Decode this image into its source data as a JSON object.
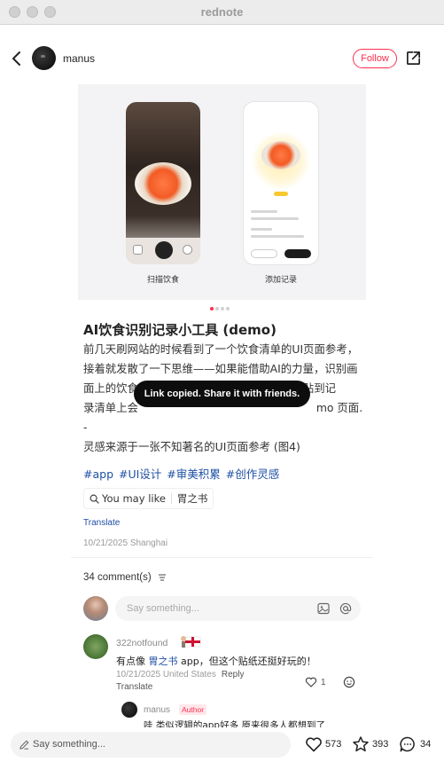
{
  "window": {
    "title": "rednote"
  },
  "header": {
    "author": "manus",
    "follow_label": "Follow"
  },
  "media": {
    "captions": [
      "扫描饮食",
      "添加记录"
    ],
    "page_count": 4,
    "active_page": 1
  },
  "post": {
    "title": "AI饮食识别记录小工具 (demo)",
    "body_lines": [
      "前几天刷网站的时候看到了一个饮食清单的UI页面参考，",
      "接着就发散了一下思维——如果能借助AI的力量，识别画",
      "面上的饮食并自动生成一张贴纸，再一键贴纸贴到记",
      "录清单上会                                                   mo 页面...",
      "-",
      "灵感来源于一张不知著名的UI页面参考 (图4)"
    ],
    "hashtags": [
      "#app",
      "#UI设计",
      "#审美积累",
      "#创作灵感"
    ],
    "may_like_label": "You may like",
    "may_like_brand": "胃之书",
    "translate_label": "Translate",
    "meta": "10/21/2025 Shanghai"
  },
  "toast": {
    "text": "Link copied. Share it with friends."
  },
  "comments": {
    "count_label": "34 comment(s)",
    "input_placeholder": "Say something...",
    "items": [
      {
        "user": "322notfound",
        "text_prefix": "有点像 ",
        "text_link": "胃之书",
        "text_suffix": " app，但这个贴纸还挺好玩的！",
        "meta": "10/21/2025 United States",
        "reply_label": "Reply",
        "translate_label": "Translate",
        "likes": "1"
      }
    ],
    "reply": {
      "user": "manus",
      "badge": "Author",
      "text": "哇 类似逻辑的app好多 原来很多人都想到了"
    }
  },
  "bottom_bar": {
    "placeholder": "Say something...",
    "likes": "573",
    "collects": "393",
    "comments": "34"
  },
  "colors": {
    "accent": "#ff2e4d",
    "link": "#1e4fa3",
    "toast_bg": "#0d0d0d"
  }
}
